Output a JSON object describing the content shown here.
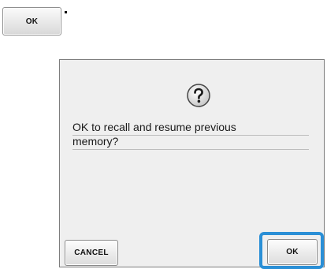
{
  "top_key": {
    "label": "OK"
  },
  "dialog": {
    "icon": "question-mark-icon",
    "message_lines": [
      "OK to recall and resume previous",
      "memory?"
    ],
    "cancel_label": "CANCEL",
    "ok_label": "OK"
  },
  "colors": {
    "dialog_background": "#efefef",
    "highlight": "#2a8fd6",
    "button_text": "#111111"
  }
}
